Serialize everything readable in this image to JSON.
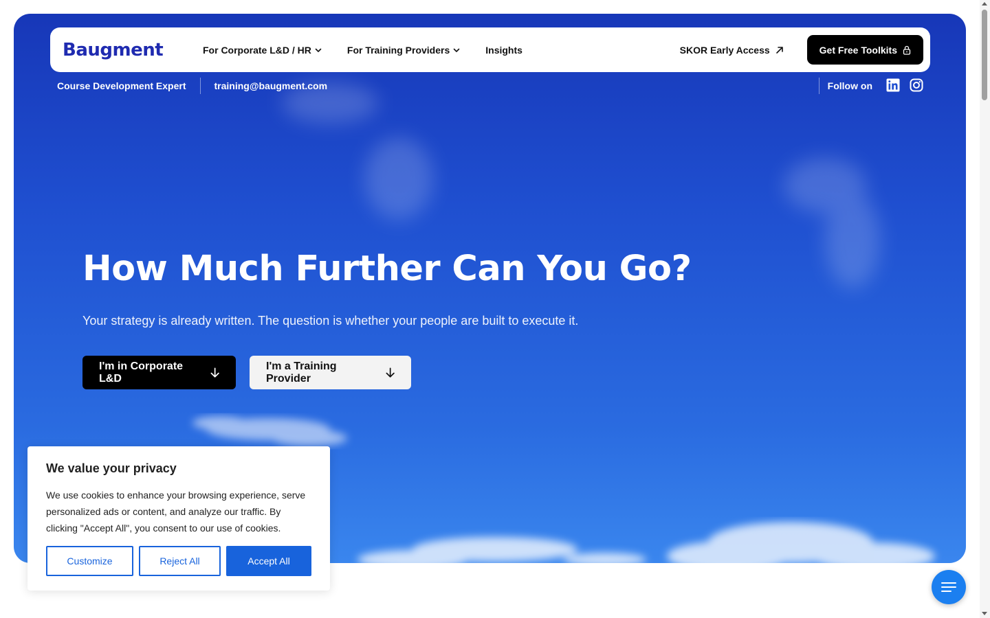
{
  "brand": {
    "logo_text": "Baugment",
    "logo_color": "#1f2bb0"
  },
  "nav": {
    "items": [
      {
        "label": "For Corporate L&D / HR",
        "has_dropdown": true
      },
      {
        "label": "For Training Providers",
        "has_dropdown": true
      },
      {
        "label": "Insights",
        "has_dropdown": false
      }
    ],
    "skor_label": "SKOR Early Access",
    "toolkit_label": "Get Free Toolkits"
  },
  "subbar": {
    "tagline": "Course Development Expert",
    "email": "training@baugment.com",
    "follow_label": "Follow on",
    "social_icons": [
      "linkedin-icon",
      "instagram-icon"
    ]
  },
  "hero": {
    "headline": "How Much Further Can You Go?",
    "subheadline": "Your strategy is already written. The question is whether your people are built to execute it.",
    "cta_primary": "I'm in Corporate L&D",
    "cta_secondary": "I'm a Training Provider"
  },
  "cookie": {
    "title": "We value your privacy",
    "body": "We use cookies to enhance your browsing experience, serve personalized ads or content, and analyze our traffic. By clicking \"Accept All\", you consent to our use of cookies.",
    "customize_label": "Customize",
    "reject_label": "Reject All",
    "accept_label": "Accept All",
    "accent_color": "#1863dc"
  },
  "fab": {
    "icon": "menu-lines-icon",
    "color": "#1b7ff0"
  }
}
